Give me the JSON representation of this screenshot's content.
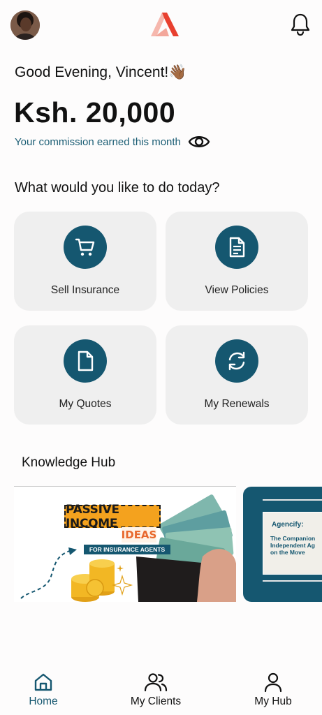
{
  "header": {
    "avatar_icon": "user-avatar",
    "logo_icon": "brand-logo",
    "notification_icon": "bell-icon"
  },
  "greeting": "Good Evening, Vincent!👋🏾",
  "commission": {
    "amount": "Ksh. 20,000",
    "label": "Your commission earned this month",
    "toggle_icon": "eye-icon"
  },
  "prompt": "What would you like to do today?",
  "actions": [
    {
      "label": "Sell Insurance",
      "icon": "cart-icon"
    },
    {
      "label": "View Policies",
      "icon": "document-list-icon"
    },
    {
      "label": "My Quotes",
      "icon": "file-icon"
    },
    {
      "label": "My Renewals",
      "icon": "refresh-icon"
    }
  ],
  "knowledge_hub": {
    "title": "Knowledge Hub",
    "cards": [
      {
        "headline": "PASSIVE INCOME",
        "highlight": "IDEAS",
        "subtitle": "FOR INSURANCE AGENTS"
      },
      {
        "headline": "Agencify:",
        "body_lines": [
          "The Companion",
          "Independent Ag",
          "on the Move"
        ]
      }
    ]
  },
  "bottom_nav": [
    {
      "label": "Home",
      "icon": "home-icon",
      "active": true
    },
    {
      "label": "My Clients",
      "icon": "users-icon",
      "active": false
    },
    {
      "label": "My Hub",
      "icon": "person-icon",
      "active": false
    }
  ],
  "colors": {
    "primary": "#155770",
    "card_bg": "#efefef",
    "accent_orange": "#f4a21e",
    "logo_red": "#e8402f"
  }
}
